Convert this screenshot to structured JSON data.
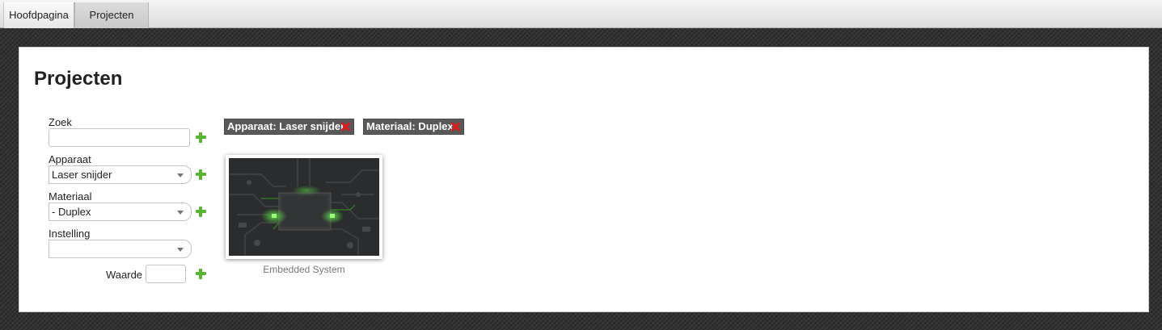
{
  "nav": {
    "tabs": [
      {
        "label": "Hoofdpagina"
      },
      {
        "label": "Projecten"
      }
    ]
  },
  "page": {
    "title": "Projecten"
  },
  "filters": {
    "zoek": {
      "label": "Zoek",
      "value": ""
    },
    "apparaat": {
      "label": "Apparaat",
      "value": "Laser snijder"
    },
    "materiaal": {
      "label": "Materiaal",
      "value": "- Duplex"
    },
    "instelling": {
      "label": "Instelling",
      "value": ""
    },
    "waarde": {
      "label": "Waarde",
      "value": ""
    }
  },
  "active_filters": [
    {
      "label": "Apparaat: Laser snijder"
    },
    {
      "label": "Materiaal: Duplex"
    }
  ],
  "projects": [
    {
      "name": "Embedded System"
    }
  ],
  "colors": {
    "add_icon": "#58b52f",
    "remove_icon": "#e01818",
    "chip_bg": "#595959"
  }
}
